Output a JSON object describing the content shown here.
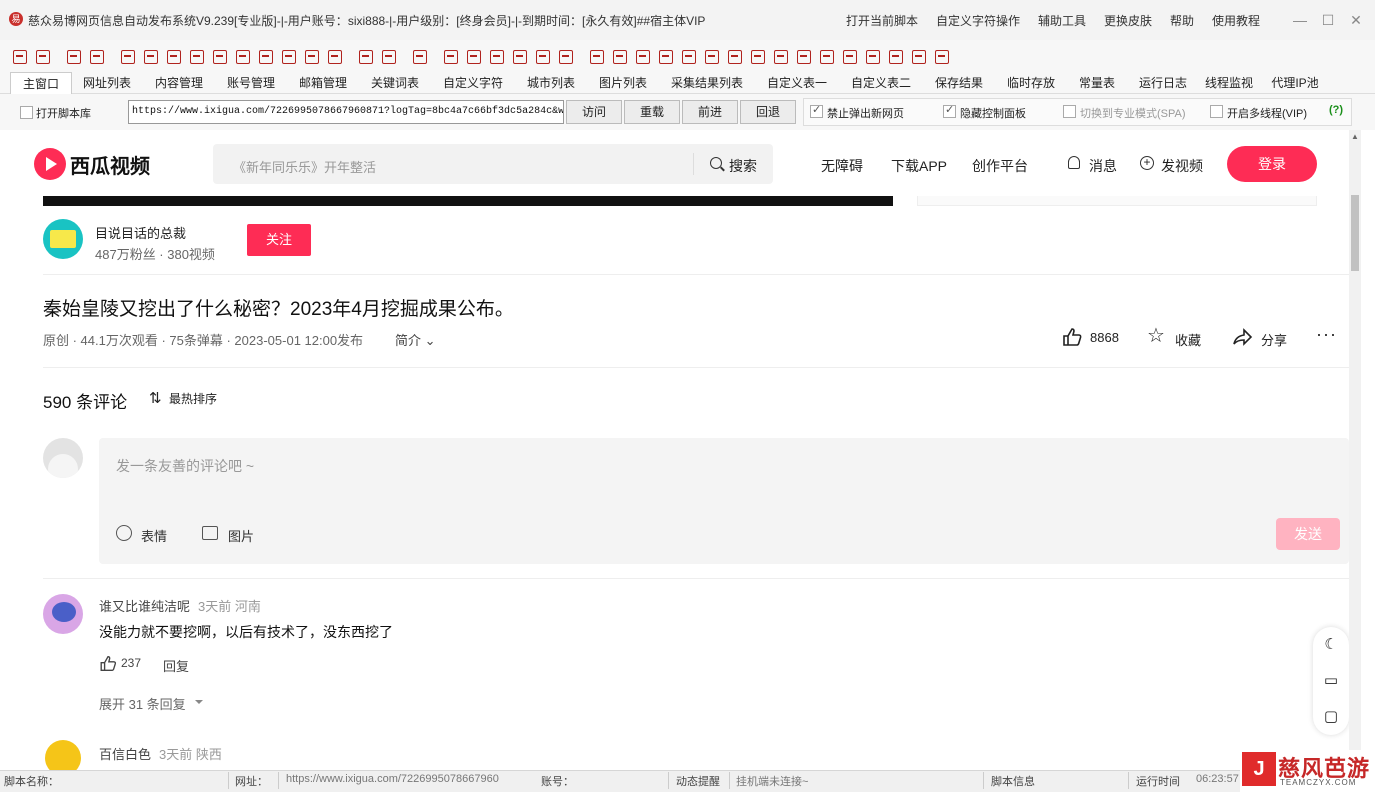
{
  "titlebar": {
    "title": "慈众易博网页信息自动发布系统V9.239[专业版]-|-用户账号：sixi888-|-用户级别：[终身会员]-|-到期时间：[永久有效]##宿主体VIP",
    "menu": [
      "打开当前脚本",
      "自定义字符操作",
      "辅助工具",
      "更换皮肤",
      "帮助",
      "使用教程"
    ]
  },
  "tabs": [
    "主窗口",
    "网址列表",
    "内容管理",
    "账号管理",
    "邮箱管理",
    "关键词表",
    "自定义字符",
    "城市列表",
    "图片列表",
    "采集结果列表",
    "自定义表一",
    "自定义表二",
    "保存结果",
    "临时存放",
    "常量表",
    "运行日志",
    "线程监视",
    "代理IP池"
  ],
  "controls": {
    "open_script_lib": "打开脚本库",
    "url": "https://www.ixigua.com/7226995078667960871?logTag=8bc4a7c66bf3dc5a284c&w",
    "nav_buttons": [
      "访问",
      "重载",
      "前进",
      "回退"
    ],
    "options": [
      {
        "label": "禁止弹出新网页",
        "checked": true
      },
      {
        "label": "隐藏控制面板",
        "checked": true
      },
      {
        "label": "切换到专业模式(SPA)",
        "checked": false
      },
      {
        "label": "开启多线程(VIP)",
        "checked": false
      }
    ],
    "help": "(?)"
  },
  "site": {
    "logo_text": "西瓜视频",
    "search_placeholder": "《新年同乐乐》开年整活",
    "search_button": "搜索",
    "nav": [
      "无障碍",
      "下载APP",
      "创作平台"
    ],
    "messages": "消息",
    "upload": "发视频",
    "login": "登录"
  },
  "author": {
    "name": "目说目话的总裁",
    "stats": "487万粉丝 · 380视频",
    "follow": "关注"
  },
  "video": {
    "title": "秦始皇陵又挖出了什么秘密？2023年4月挖掘成果公布。",
    "meta": "原创 · 44.1万次观看 · 75条弹幕 · 2023-05-01 12:00发布",
    "intro": "简介",
    "likes": "8868",
    "collect": "收藏",
    "share": "分享"
  },
  "comments": {
    "count_label": "590 条评论",
    "sort_label": "最热排序",
    "input_placeholder": "发一条友善的评论吧 ~",
    "emoji": "表情",
    "image": "图片",
    "send": "发送",
    "items": [
      {
        "user": "谁又比谁纯洁呢",
        "time": "3天前 河南",
        "text": "没能力就不要挖啊，以后有技术了，没东西挖了",
        "likes": "237",
        "reply": "回复",
        "expand": "展开 31 条回复"
      },
      {
        "user": "百信白色",
        "time": "3天前 陕西"
      }
    ]
  },
  "statusbar": {
    "script_name_label": "脚本名称：",
    "url_label": "网址：",
    "url_value": "https://www.ixigua.com/7226995078667960",
    "account_label": "账号：",
    "dynamic_label": "动态提醒",
    "hang_status": "挂机端未连接~",
    "script_info_label": "脚本信息",
    "run_time_label": "运行时间",
    "run_time_value": "06:23:57"
  },
  "watermark": {
    "text": "慈风芭游",
    "sub": "TEAMCZYX.COM"
  },
  "colors": {
    "brand": "#fe2c55",
    "send_disabled": "#ffb3c1",
    "app_icon": "#b0231e"
  }
}
